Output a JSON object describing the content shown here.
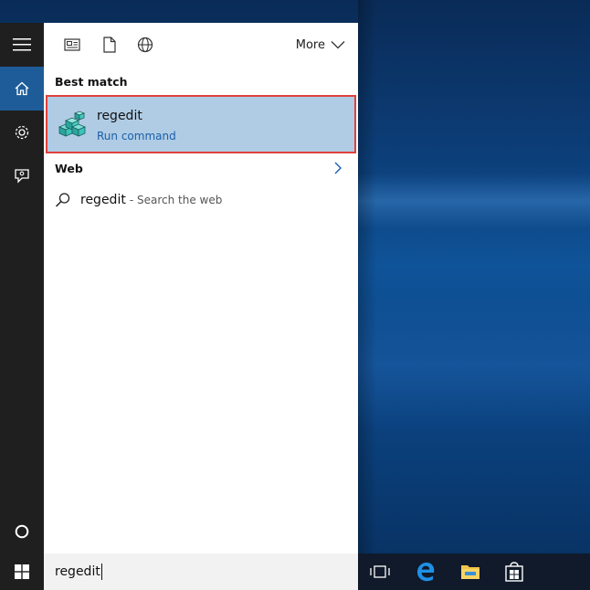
{
  "toolbar": {
    "more_label": "More"
  },
  "results": {
    "best_match_heading": "Best match",
    "best_match": {
      "title": "regedit",
      "subtitle": "Run command"
    },
    "web_heading": "Web",
    "web_result": {
      "query": "regedit",
      "suffix": "- Search the web"
    }
  },
  "taskbar": {
    "search_value": "regedit"
  },
  "icons": {
    "rail": [
      "hamburger-menu-icon",
      "home-icon",
      "gear-icon",
      "feedback-icon",
      "cortana-circle-icon"
    ],
    "toolbar": [
      "apps-icon",
      "documents-icon",
      "web-globe-icon",
      "chevron-down-icon"
    ],
    "taskbar": [
      "windows-logo-icon",
      "task-view-icon",
      "edge-icon",
      "file-explorer-icon",
      "store-icon"
    ]
  },
  "colors": {
    "accent": "#1e5c99",
    "selection": "#b0cce5",
    "highlight_border": "#e0403c",
    "link": "#1a5fa8"
  }
}
